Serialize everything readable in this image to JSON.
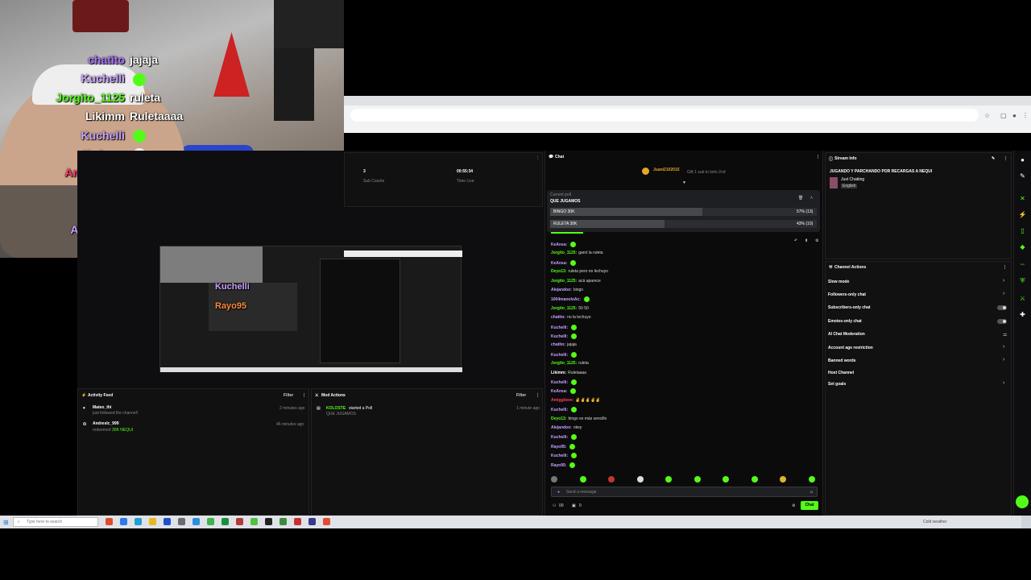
{
  "webcam_overlay": [
    {
      "user": "chatito",
      "message": "jajaja",
      "color": "#a970ff"
    },
    {
      "user": "Kuchelli",
      "message": "",
      "color": "#c9a2ff",
      "emote": "green-emote"
    },
    {
      "user": "Jorgito_1125",
      "message": "ruleta",
      "color": "#53fc18"
    },
    {
      "user": "Likimm",
      "message": "Ruletaaaa",
      "color": "#ffffff"
    },
    {
      "user": "Kuchelli",
      "message": "",
      "color": "#c9a2ff",
      "emote": "green-emote"
    },
    {
      "user": "KeAnsa",
      "message": "",
      "color": "#c9a2ff",
      "emote": "skull-emote"
    },
    {
      "user": "Amiggiieee",
      "message": "✌✌✌✌✌",
      "color": "#ff3b6b"
    },
    {
      "user": "Kuchelli",
      "message": "",
      "color": "#c9a2ff",
      "emote": "face-emote"
    },
    {
      "user": "Deyo13",
      "message": "bingo es más sencillo",
      "color": "#6bc7ff"
    },
    {
      "user": "Alejandoo",
      "message": "okey",
      "color": "#c9a2ff"
    },
    {
      "user": "Kuchelli",
      "message": "",
      "color": "#c9a2ff"
    },
    {
      "user": "Rayo95",
      "message": "",
      "color": "#ff8a3d",
      "emote": "face-emote"
    }
  ],
  "stats": {
    "sub_count_value": "3",
    "sub_count_label": "Sub Counts",
    "time_live_value": "00:55:34",
    "time_live_label": "Time Live"
  },
  "activity_feed": {
    "title": "Activity Feed",
    "filter": "Filter",
    "items": [
      {
        "user": "Mateo_thi",
        "text": "just followed the channel!",
        "time": "2 minutes ago"
      },
      {
        "user": "Andreslc_999",
        "text": "redeemed",
        "reward": "30K NEQUI",
        "time": "46 minutes ago"
      }
    ]
  },
  "mod_actions": {
    "title": "Mod Actions",
    "filter": "Filter",
    "items": [
      {
        "user": "KOLOSTE",
        "action": "started a Poll",
        "detail": "QUE JUGAMOS",
        "time": "1 minute ago"
      }
    ]
  },
  "chat": {
    "title": "Chat",
    "pinned_user": "Juani2102015",
    "pinned_text": "Gift 1 sub to lorlo 2nd",
    "poll": {
      "label": "Current poll",
      "question": "QUE JUGAMOS",
      "options": [
        {
          "name": "BINGO 30K",
          "percent": 57,
          "result": "57% (13)"
        },
        {
          "name": "RULETA 30K",
          "percent": 43,
          "result": "43% (10)"
        }
      ]
    },
    "messages": [
      {
        "user": "KeAnsa:",
        "text": "",
        "color": "#c9a2ff",
        "emote": true
      },
      {
        "user": "Jorgito_1125:",
        "text": "ganó la ruleta",
        "color": "#53fc18"
      },
      {
        "user": "KeAnsa:",
        "text": "",
        "color": "#c9a2ff",
        "emote": true
      },
      {
        "user": "Deyo13:",
        "text": "ruleta pero no lechuyo",
        "color": "#53fc18"
      },
      {
        "user": "Jorgito_1125:",
        "text": "acá aparece",
        "color": "#53fc18"
      },
      {
        "user": "Alejandoo:",
        "text": "bingo",
        "color": "#c9a2ff"
      },
      {
        "user": "1004manoloAc:",
        "text": "",
        "color": "#c9a2ff",
        "emote": true
      },
      {
        "user": "Jorgito_1125:",
        "text": "50 50",
        "color": "#53fc18"
      },
      {
        "user": "chatito:",
        "text": "no la lechuyo",
        "color": "#c9a2ff"
      },
      {
        "user": "Kuchelli:",
        "text": "",
        "color": "#c9a2ff",
        "emote": true
      },
      {
        "user": "Kuchelli:",
        "text": "",
        "color": "#c9a2ff",
        "emote": true
      },
      {
        "user": "chatito:",
        "text": "jajaja",
        "color": "#c9a2ff"
      },
      {
        "user": "Kuchelli:",
        "text": "",
        "color": "#c9a2ff",
        "emote": true
      },
      {
        "user": "Jorgito_1125:",
        "text": "ruleta",
        "color": "#53fc18"
      },
      {
        "user": "Likimm:",
        "text": "Ruletaaaa",
        "color": "#ffffff"
      },
      {
        "user": "Kuchelli:",
        "text": "",
        "color": "#c9a2ff",
        "emote": true
      },
      {
        "user": "KeAnsa:",
        "text": "",
        "color": "#c9a2ff",
        "emote": true
      },
      {
        "user": "Amiggiieee:",
        "text": "✌✌✌✌✌",
        "color": "#ff3b6b"
      },
      {
        "user": "Kuchelli:",
        "text": "",
        "color": "#c9a2ff",
        "emote": true
      },
      {
        "user": "Deyo13:",
        "text": "bingo es más sencillo",
        "color": "#53fc18"
      },
      {
        "user": "Alejandoo:",
        "text": "okey",
        "color": "#c9a2ff"
      },
      {
        "user": "Kuchelli:",
        "text": "",
        "color": "#c9a2ff",
        "emote": true
      },
      {
        "user": "Rayo95:",
        "text": "",
        "color": "#c9a2ff",
        "emote": true
      },
      {
        "user": "Kuchelli:",
        "text": "",
        "color": "#c9a2ff",
        "emote": true
      },
      {
        "user": "Rayo95:",
        "text": "",
        "color": "#c9a2ff",
        "emote": true
      }
    ],
    "input_placeholder": "Send a message",
    "viewer_count": "00",
    "kicks": "0",
    "send_label": "Chat"
  },
  "stream_info": {
    "title": "Stream Info",
    "stream_title": "JUGANDO Y PARCHANDO POR RECARGAS A NEQUI",
    "category": "Just Chatting",
    "language": "English"
  },
  "channel_actions": {
    "title": "Channel Actions",
    "items": [
      {
        "label": "Slow mode",
        "control": "chevron"
      },
      {
        "label": "Followers-only chat",
        "control": "chevron"
      },
      {
        "label": "Subscribers-only chat",
        "control": "toggle"
      },
      {
        "label": "Emotes-only chat",
        "control": "toggle"
      },
      {
        "label": "AI Chat Moderation",
        "control": "icon"
      },
      {
        "label": "Account age restriction",
        "control": "chevron"
      },
      {
        "label": "Banned words",
        "control": "chevron"
      },
      {
        "label": "Host Channel",
        "control": "none"
      },
      {
        "label": "Set goals",
        "control": "chevron"
      }
    ]
  },
  "taskbar": {
    "search_placeholder": "Type here to search",
    "weather": "Cold weather"
  },
  "preview_overlay": [
    {
      "user": "Kuchelli"
    },
    {
      "user": "Rayo95"
    }
  ]
}
